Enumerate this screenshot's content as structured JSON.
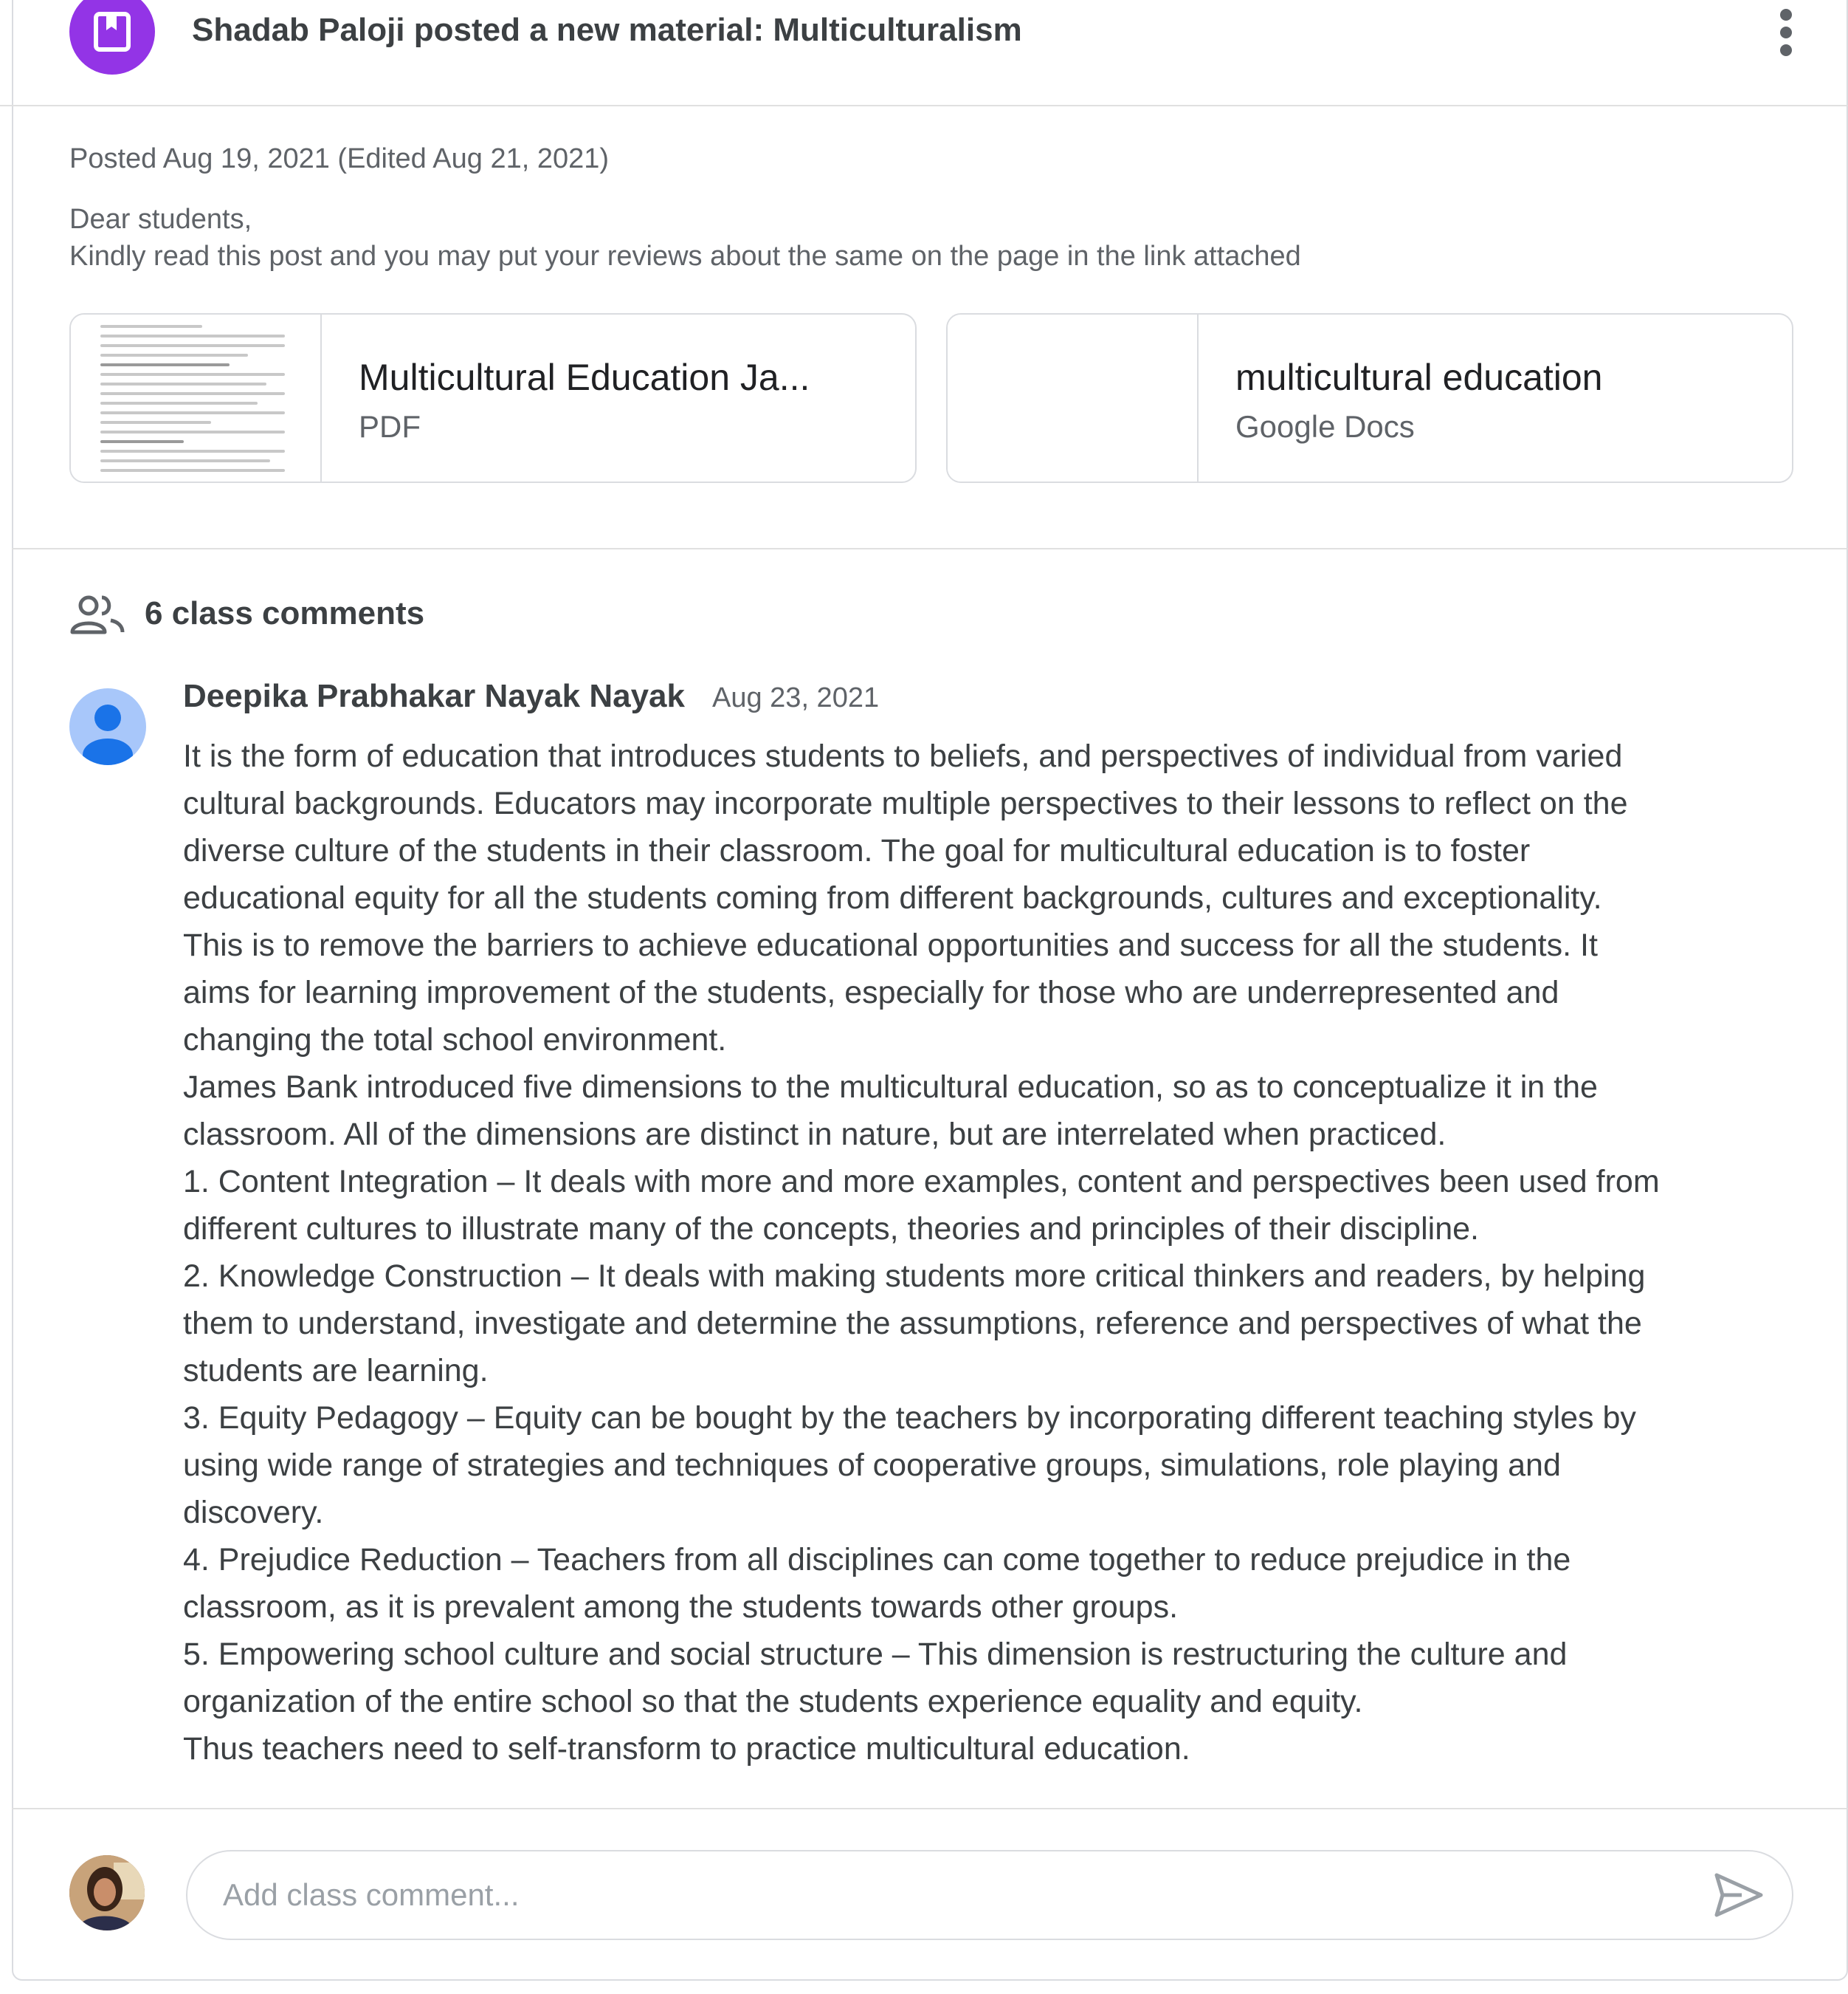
{
  "post": {
    "header_title": "Shadab Paloji posted a new material: Multiculturalism",
    "icon": "material-book-icon",
    "posted_date": "Posted Aug 19, 2021 (Edited Aug 21, 2021)",
    "description_lines": [
      "Dear students,",
      "Kindly read this post and you may put your reviews about the same on the page in the link attached"
    ],
    "attachments": [
      {
        "title": "Multicultural Education Ja...",
        "type": "PDF"
      },
      {
        "title": "multicultural education",
        "type": "Google Docs"
      }
    ]
  },
  "comments": {
    "count_label": "6 class comments",
    "icon": "people-icon",
    "items": [
      {
        "author": "Deepika Prabhakar Nayak Nayak",
        "date": "Aug 23, 2021",
        "lines": [
          "It is the form of education that introduces students to  beliefs, and perspectives of individual from varied",
          "cultural backgrounds. Educators may incorporate multiple perspectives to their lessons to reflect on the",
          "diverse culture of the students in their classroom. The goal for multicultural education is to foster",
          "educational equity for all the students coming from different backgrounds, cultures and exceptionality.",
          "This is to remove the barriers to achieve educational opportunities and success for all the students. It",
          "aims for learning improvement of the students, especially for those who are underrepresented and",
          "changing the total school environment.",
          "James Bank introduced five dimensions to the multicultural education, so as to conceptualize it in the",
          "classroom. All of the dimensions are distinct in nature, but are interrelated when practiced.",
          "1. Content Integration – It deals with more and more examples, content and perspectives been used from",
          "different cultures to illustrate many of the concepts, theories and principles of their discipline.",
          "2. Knowledge Construction – It deals with making students more critical thinkers and readers, by helping",
          "them to understand, investigate and determine the assumptions, reference and perspectives of what the",
          "students are learning.",
          "3. Equity Pedagogy – Equity can be bought by the teachers by incorporating different teaching styles by",
          "using wide range of strategies and techniques of cooperative groups, simulations, role playing and",
          "discovery.",
          "4. Prejudice Reduction – Teachers from all disciplines can come together to reduce prejudice in the",
          "classroom, as it is prevalent among the students towards other groups.",
          "5. Empowering school culture and social structure – This dimension is restructuring the culture and",
          "organization of the entire school so that the students experience equality and equity.",
          "Thus teachers need to self-transform to practice multicultural education."
        ]
      }
    ],
    "input_placeholder": "Add class comment...",
    "input_value": ""
  },
  "colors": {
    "material_icon_bg": "#9334e6",
    "avatar_bg": "#a8c7fa",
    "avatar_fg": "#1a73e8"
  }
}
